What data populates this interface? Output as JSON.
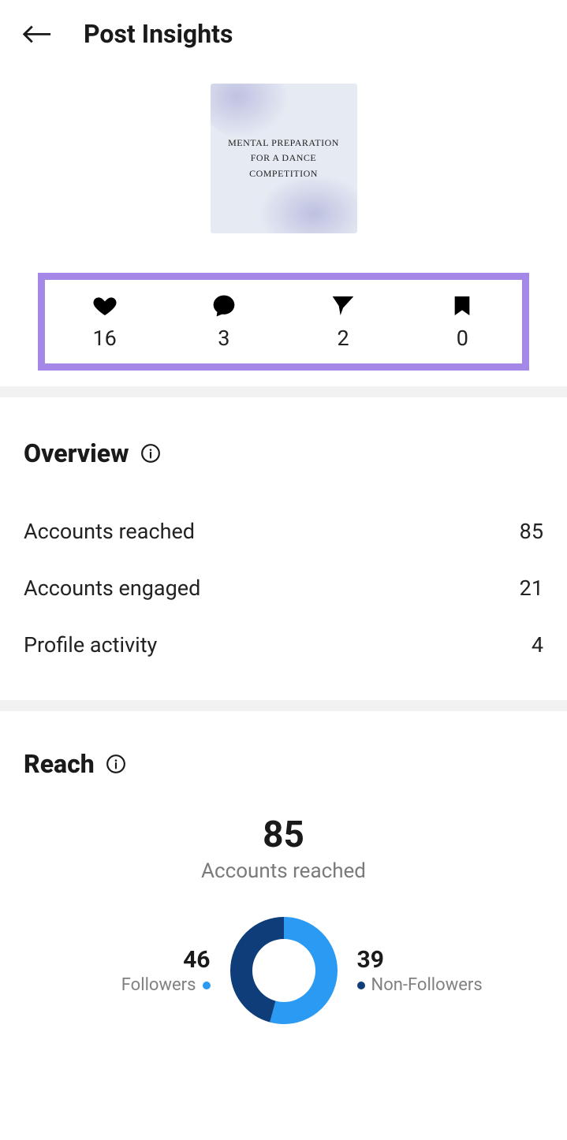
{
  "header": {
    "title": "Post Insights"
  },
  "thumbnail": {
    "line1": "MENTAL PREPARATION",
    "line2": "FOR A DANCE",
    "line3": "COMPETITION"
  },
  "stats": {
    "likes": "16",
    "comments": "3",
    "shares": "2",
    "saves": "0"
  },
  "overview": {
    "title": "Overview",
    "rows": {
      "reached_label": "Accounts reached",
      "reached_value": "85",
      "engaged_label": "Accounts engaged",
      "engaged_value": "21",
      "profile_label": "Profile activity",
      "profile_value": "4"
    }
  },
  "reach": {
    "title": "Reach",
    "big": "85",
    "sub": "Accounts reached",
    "followers_value": "46",
    "followers_label": "Followers",
    "nonfollowers_value": "39",
    "nonfollowers_label": "Non-Followers"
  },
  "chart_data": {
    "type": "pie",
    "title": "Accounts reached",
    "total": 85,
    "series": [
      {
        "name": "Followers",
        "value": 46,
        "color": "#2b9af3"
      },
      {
        "name": "Non-Followers",
        "value": 39,
        "color": "#0f3d7a"
      }
    ]
  }
}
